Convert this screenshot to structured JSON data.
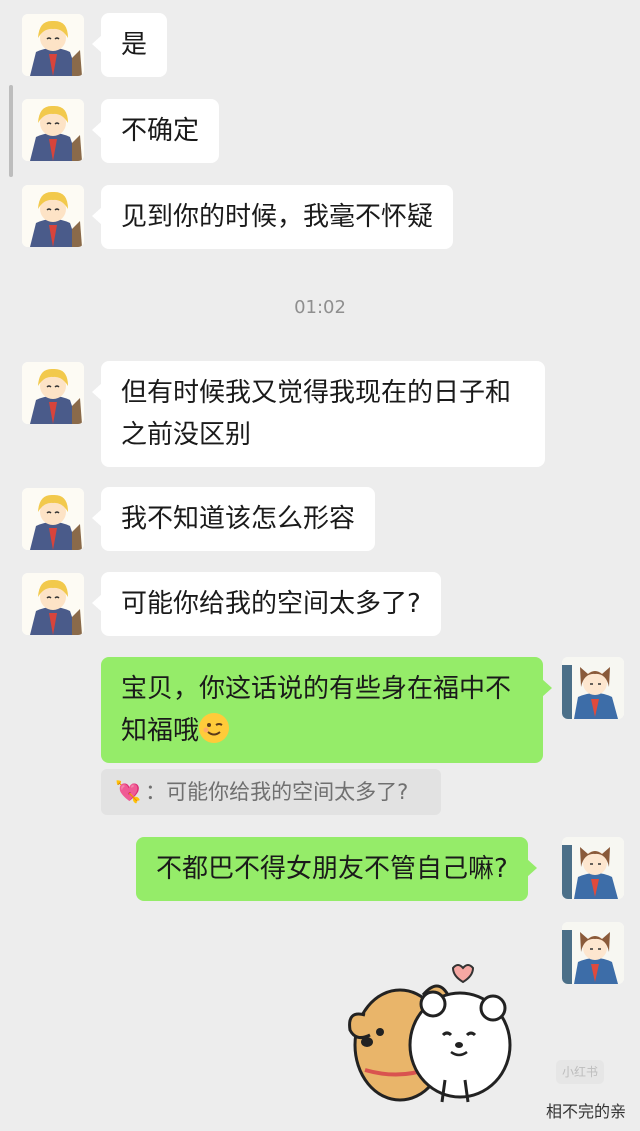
{
  "messages": [
    {
      "side": "in",
      "text": "是"
    },
    {
      "side": "in",
      "text": "不确定"
    },
    {
      "side": "in",
      "text": "见到你的时候，我毫不怀疑"
    },
    {
      "side": "in",
      "text": "但有时候我又觉得我现在的日子和之前没区别"
    },
    {
      "side": "in",
      "text": "我不知道该怎么形容"
    },
    {
      "side": "in",
      "text": "可能你给我的空间太多了?"
    },
    {
      "side": "out",
      "text": "宝贝，你这话说的有些身在福中不知福哦",
      "emoji": "wink-emoji"
    },
    {
      "side": "out",
      "text": "不都巴不得女朋友不管自己嘛?"
    }
  ],
  "timestamp": "01:02",
  "quote": {
    "icon": "heart-arrow-emoji",
    "sender_sep": "：",
    "text": "可能你给我的空间太多了?"
  },
  "sticker": {
    "icon": "dog-and-bear-hug-sticker"
  },
  "watermark": {
    "badge": "小红书",
    "text": "相不完的亲"
  },
  "colors": {
    "background": "#ededed",
    "incoming_bubble": "#ffffff",
    "outgoing_bubble": "#95ec69",
    "timestamp": "#8f8f8f"
  }
}
